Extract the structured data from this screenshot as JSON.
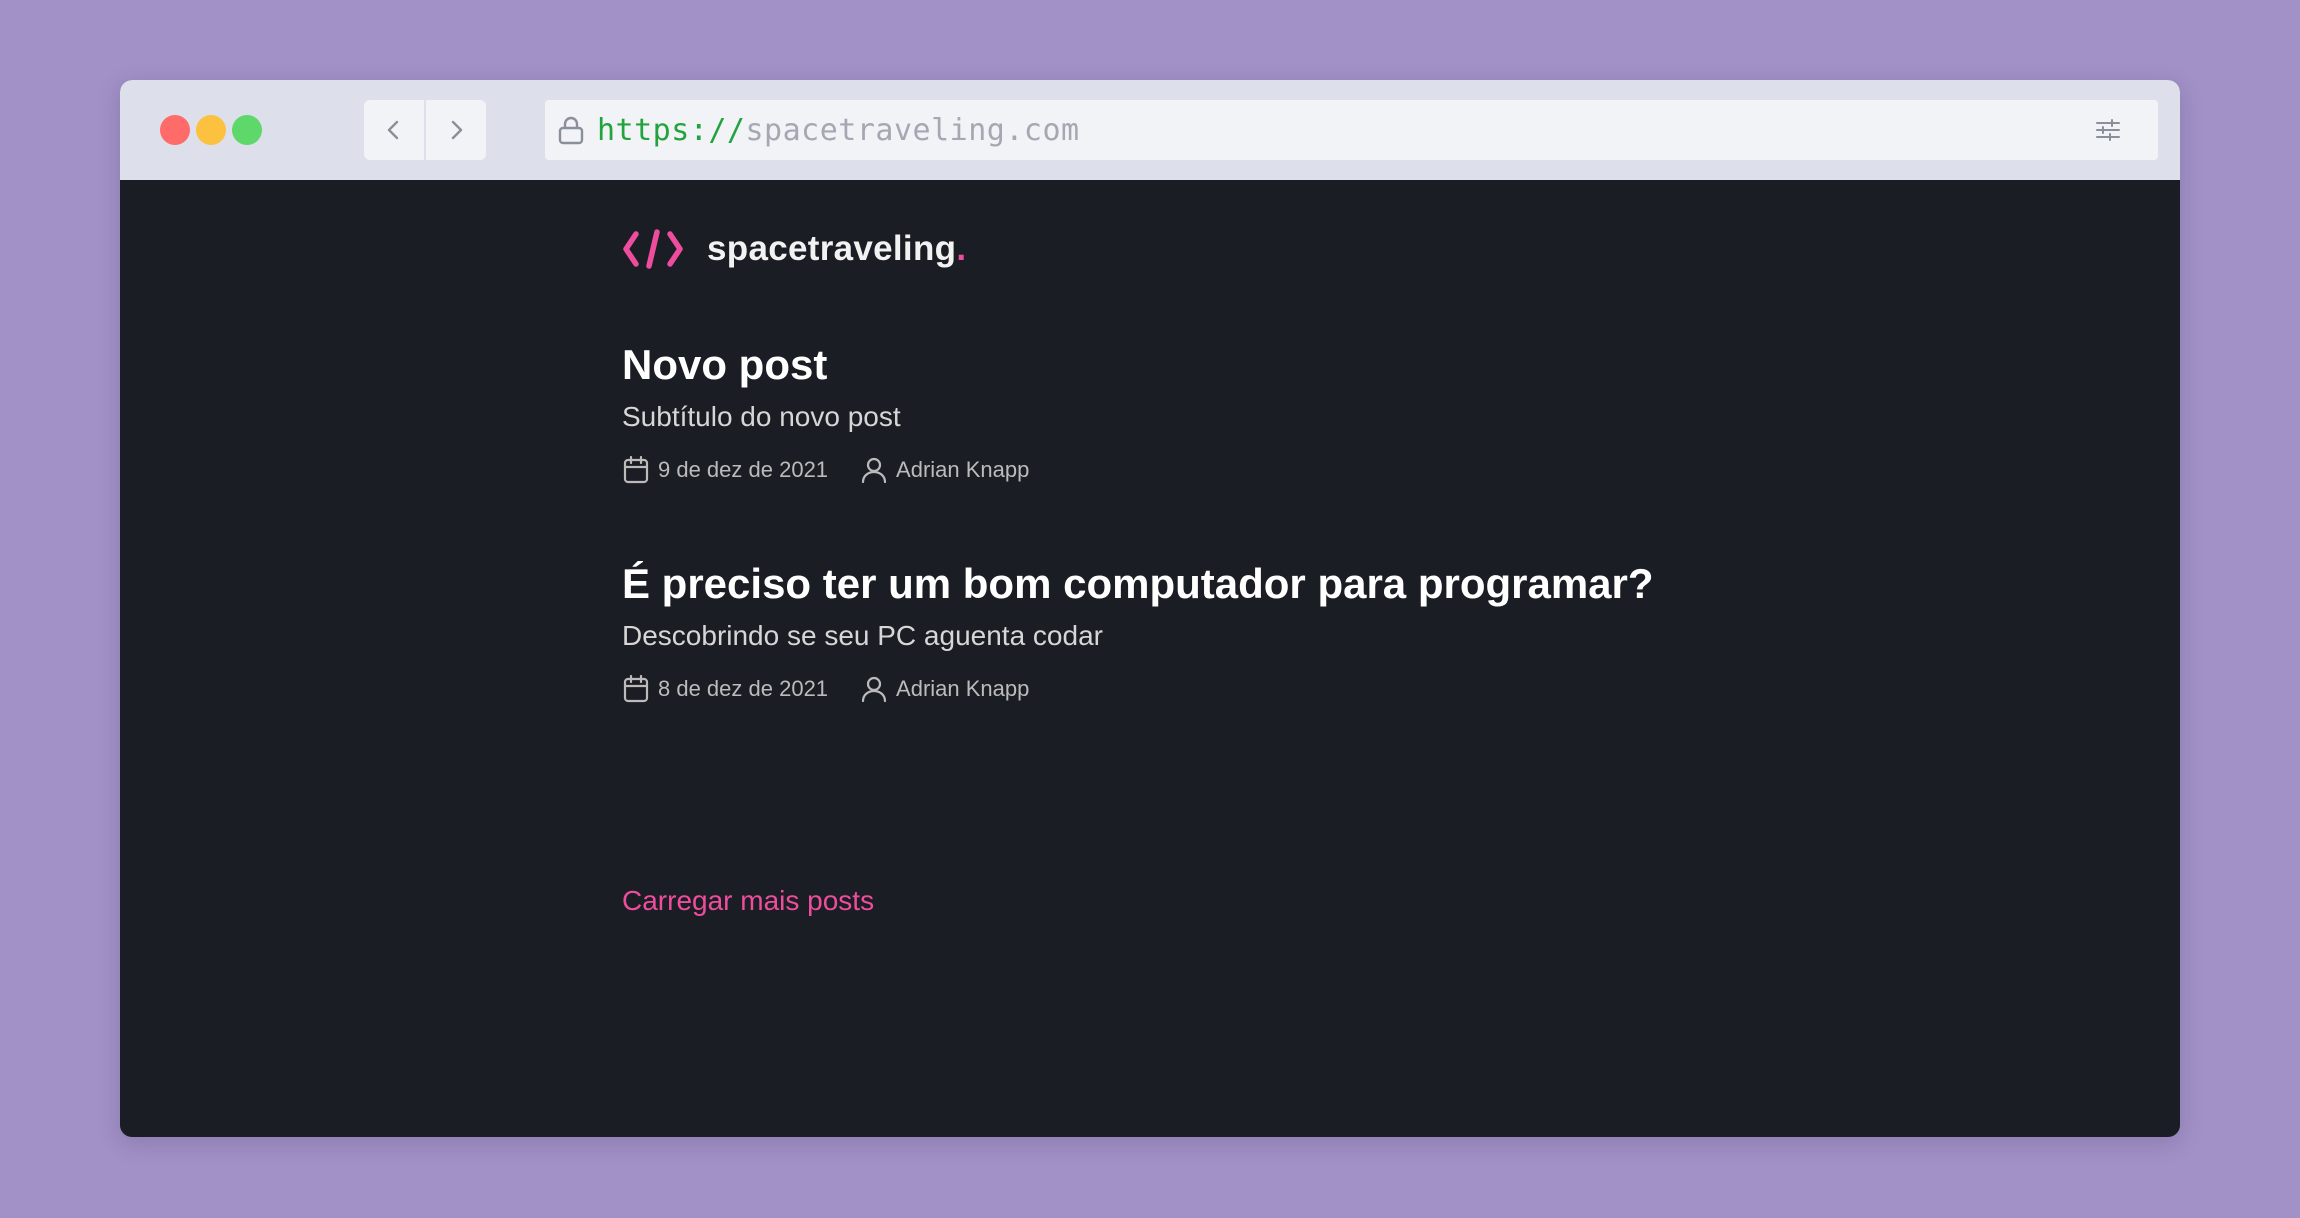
{
  "browser": {
    "url_scheme": "https://",
    "url_host": "spacetraveling.com",
    "traffic_light_colors": {
      "close": "#ff6b69",
      "minimize": "#fdc140",
      "maximize": "#5ed86b"
    }
  },
  "site": {
    "logo_icon": "code-brackets-icon",
    "logo_text": "spacetraveling",
    "logo_dot": ".",
    "accent_color": "#ee4d9d",
    "background_color": "#1b1d24"
  },
  "posts": [
    {
      "title": "Novo post",
      "subtitle": "Subtítulo do novo post",
      "date": "9 de dez de 2021",
      "author": "Adrian Knapp"
    },
    {
      "title": "É preciso ter um bom computador para programar?",
      "subtitle": "Descobrindo se seu PC aguenta codar",
      "date": "8 de dez de 2021",
      "author": "Adrian Knapp"
    }
  ],
  "load_more_label": "Carregar mais posts"
}
